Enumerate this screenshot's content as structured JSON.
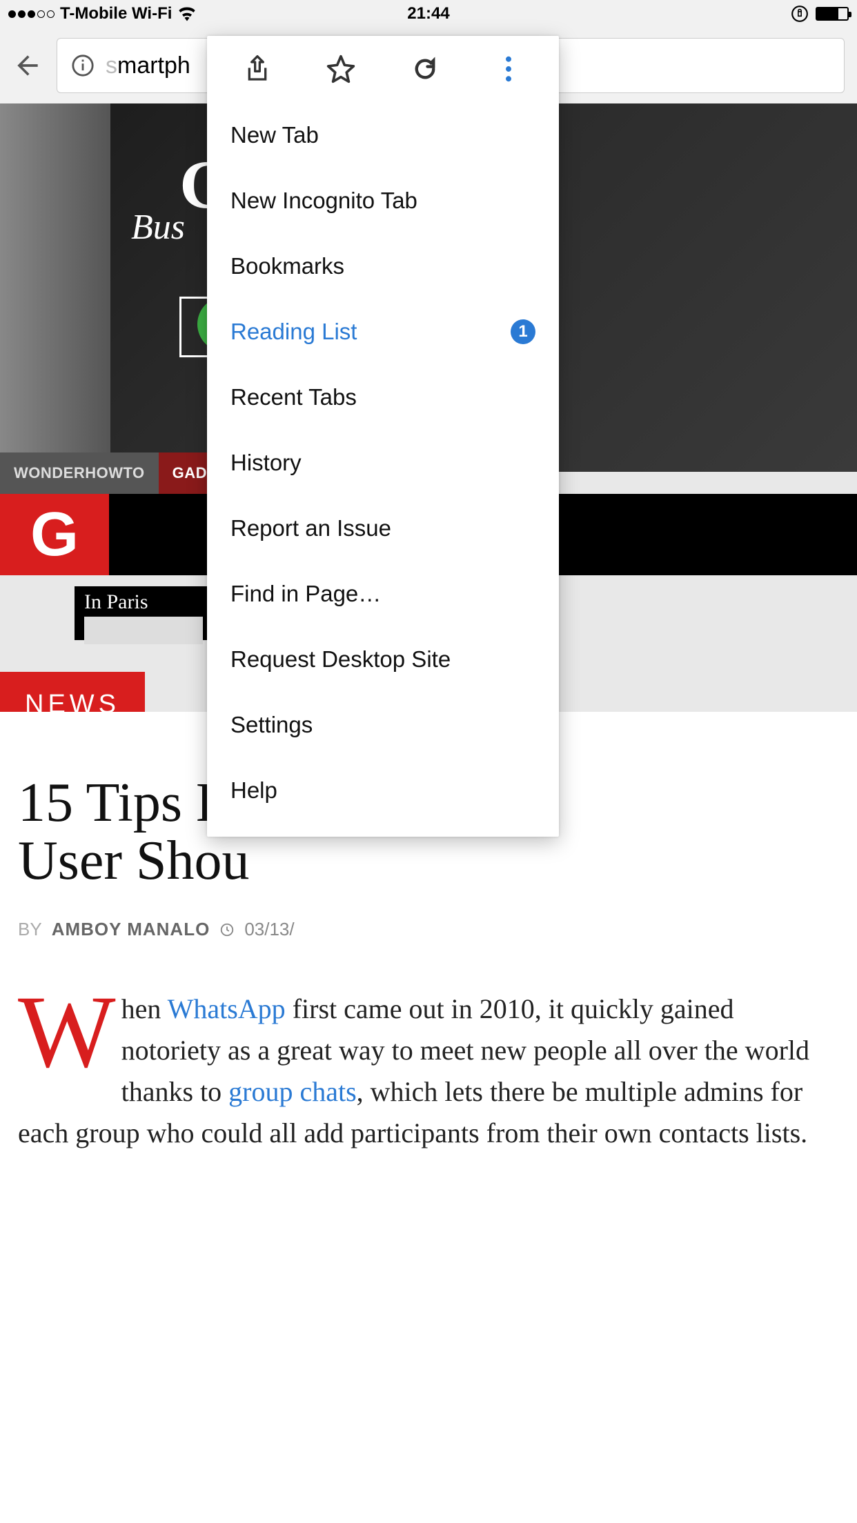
{
  "status_bar": {
    "carrier": "T-Mobile Wi-Fi",
    "time": "21:44"
  },
  "toolbar": {
    "url_faded": "s",
    "url_text": "martph"
  },
  "menu": {
    "items": [
      {
        "label": "New Tab",
        "highlight": false
      },
      {
        "label": "New Incognito Tab",
        "highlight": false
      },
      {
        "label": "Bookmarks",
        "highlight": false
      },
      {
        "label": "Reading List",
        "highlight": true,
        "badge": "1"
      },
      {
        "label": "Recent Tabs",
        "highlight": false
      },
      {
        "label": "History",
        "highlight": false
      },
      {
        "label": "Report an Issue",
        "highlight": false
      },
      {
        "label": "Find in Page…",
        "highlight": false
      },
      {
        "label": "Request Desktop Site",
        "highlight": false
      },
      {
        "label": "Settings",
        "highlight": false
      },
      {
        "label": "Help",
        "highlight": false
      }
    ]
  },
  "page": {
    "nav_wonder": "WONDERHOWTO",
    "nav_gadget": "GADGET HACKS",
    "logo_letter": "G",
    "hero_g": "G",
    "hero_bus": "Bus",
    "paris": "In Paris",
    "news_label": "NEWS",
    "headline": "15 Tips Eve\nUser Shou",
    "by": "BY",
    "author": "AMBOY MANALO",
    "date": "03/13/",
    "dropcap": "W",
    "body_start": "hen ",
    "link_whatsapp": "WhatsApp",
    "body_mid1": " first came out in 2010, it quickly gained notoriety as a great way to meet new people all over the world thanks to ",
    "link_group": "group chats",
    "body_mid2": ", which lets there be multiple admins for each group who could all add participants from their own contacts lists."
  }
}
